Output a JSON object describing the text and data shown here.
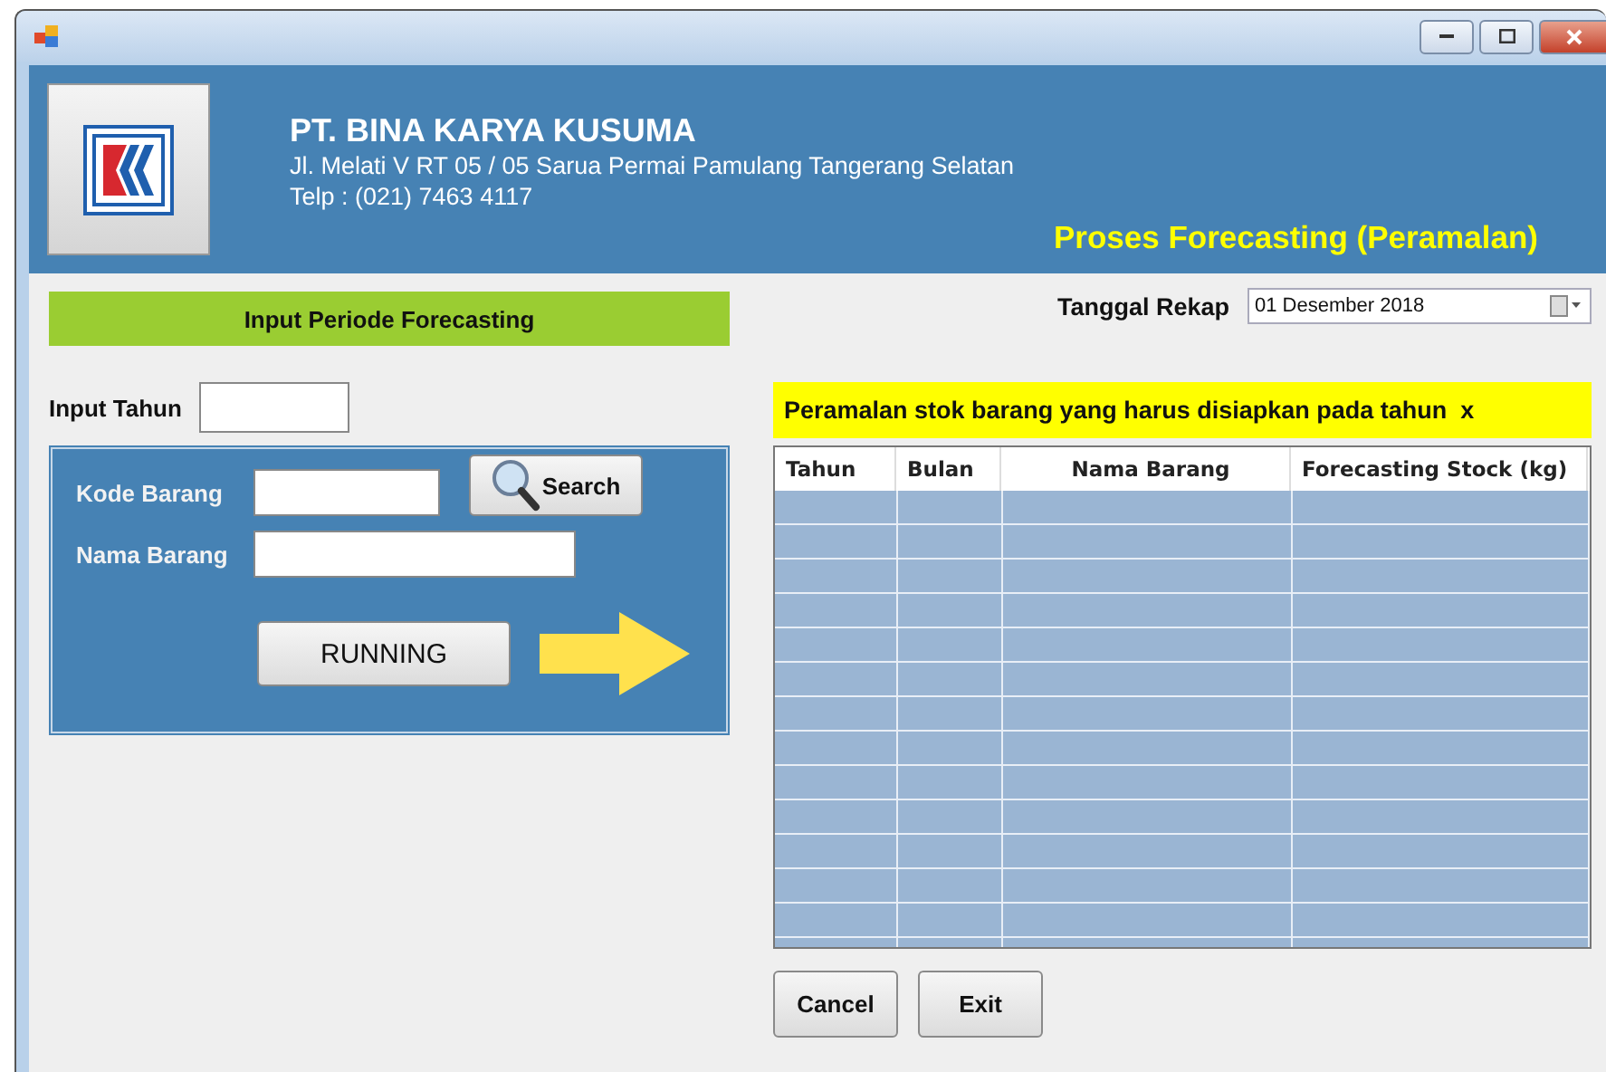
{
  "header": {
    "company": "PT. BINA KARYA KUSUMA",
    "address": "Jl. Melati V RT 05 / 05 Sarua Permai Pamulang Tangerang Selatan",
    "phone": "Telp : (021) 7463 4117",
    "form_title": "Proses Forecasting (Peramalan)"
  },
  "period_section": {
    "title": "Input Periode Forecasting"
  },
  "recap_date": {
    "label": "Tanggal Rekap",
    "value": "01 Desember 2018"
  },
  "year_input": {
    "label": "Input Tahun"
  },
  "item_panel": {
    "code_label": "Kode Barang",
    "name_label": "Nama Barang",
    "search_button": "Search",
    "run_button": "RUNNING"
  },
  "result": {
    "banner": "Peramalan stok barang yang harus disiapkan pada tahun  x",
    "columns": [
      "Tahun",
      "Bulan",
      "Nama Barang",
      "Forecasting Stock (kg)"
    ]
  },
  "buttons": [
    "Cancel",
    "Exit"
  ]
}
